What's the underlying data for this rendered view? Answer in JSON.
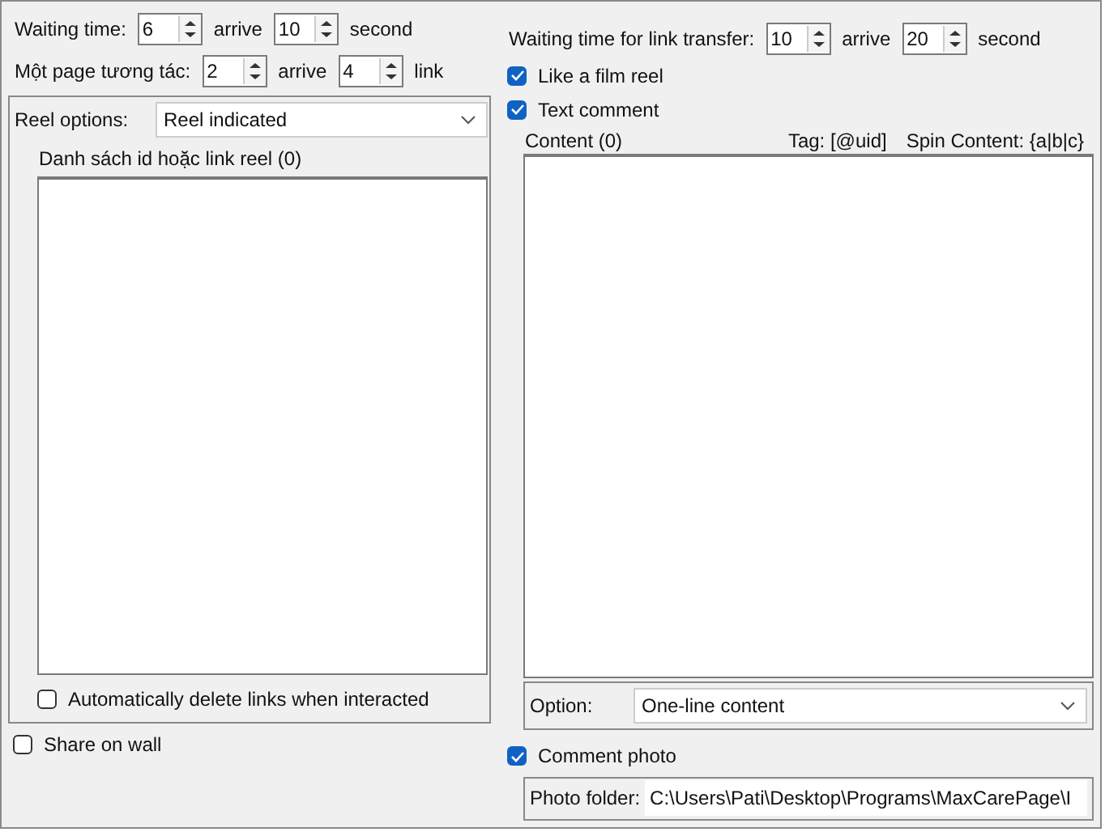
{
  "waiting_time": {
    "label": "Waiting time:",
    "from": "6",
    "between": "arrive",
    "to": "10",
    "unit": "second"
  },
  "page_interaction": {
    "label": "Một page tương tác:",
    "from": "2",
    "between": "arrive",
    "to": "4",
    "unit": "link"
  },
  "reel_options": {
    "label": "Reel options:",
    "value": "Reel indicated"
  },
  "reel_list": {
    "title": "Danh sách id hoặc link reel (0)"
  },
  "auto_delete": {
    "label": "Automatically delete links when interacted",
    "checked": false
  },
  "share_on_wall": {
    "label": "Share on wall",
    "checked": false
  },
  "link_transfer": {
    "label": "Waiting time for link transfer:",
    "from": "10",
    "between": "arrive",
    "to": "20",
    "unit": "second"
  },
  "like_reel": {
    "label": "Like a film reel",
    "checked": true
  },
  "text_comment": {
    "label": "Text comment",
    "checked": true
  },
  "content": {
    "title": "Content (0)",
    "tag": "Tag: [@uid]",
    "spin": "Spin Content: {a|b|c}"
  },
  "option": {
    "label": "Option:",
    "value": "One-line content"
  },
  "comment_photo": {
    "label": "Comment photo",
    "checked": true
  },
  "photo_folder": {
    "label": "Photo folder:",
    "value": "C:\\Users\\Pati\\Desktop\\Programs\\MaxCarePage\\I"
  }
}
